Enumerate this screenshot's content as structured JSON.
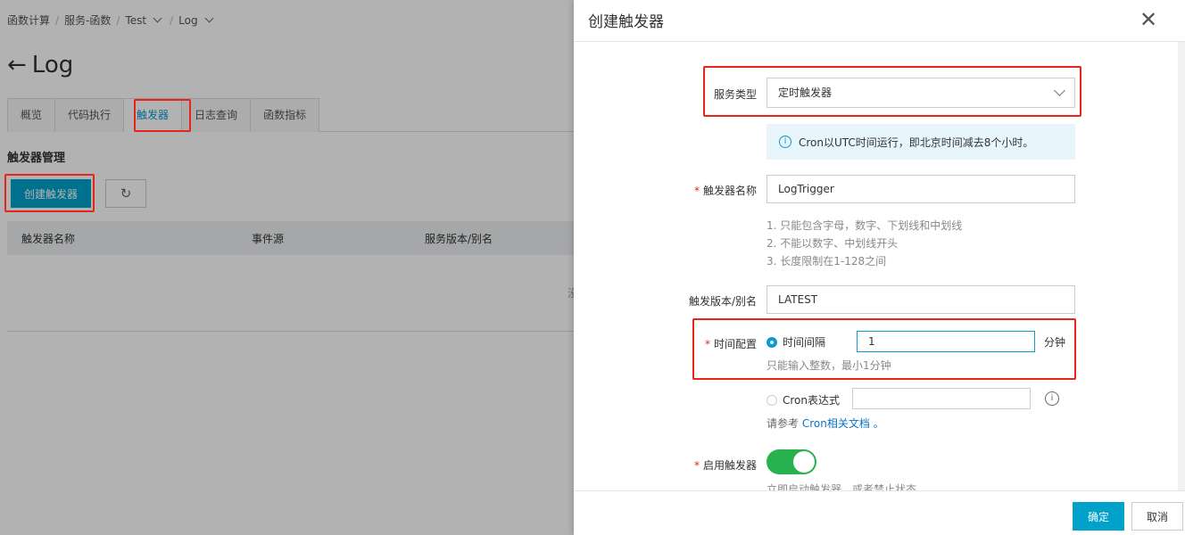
{
  "breadcrumb": {
    "items": [
      "函数计算",
      "服务-函数",
      "Test",
      "Log"
    ]
  },
  "page_title": "Log",
  "tabs": [
    "概览",
    "代码执行",
    "触发器",
    "日志查询",
    "函数指标"
  ],
  "section_title": "触发器管理",
  "create_trigger_button": "创建触发器",
  "table": {
    "headers": [
      "触发器名称",
      "事件源",
      "服务版本/别名"
    ],
    "partial_text": "没"
  },
  "panel": {
    "title": "创建触发器",
    "service_type_label": "服务类型",
    "service_type_value": "定时触发器",
    "info_text": "Cron以UTC时间运行，即北京时间减去8个小时。",
    "trigger_name_label": "触发器名称",
    "trigger_name_value": "LogTrigger",
    "name_rules": [
      "1. 只能包含字母，数字、下划线和中划线",
      "2. 不能以数字、中划线开头",
      "3. 长度限制在1-128之间"
    ],
    "version_label": "触发版本/别名",
    "version_value": "LATEST",
    "time_config_label": "时间配置",
    "interval_option": "时间间隔",
    "interval_value": "1",
    "interval_unit": "分钟",
    "interval_hint": "只能输入整数，最小1分钟",
    "cron_option": "Cron表达式",
    "cron_value": "",
    "cron_ref_prefix": "请参考",
    "cron_ref_link": "Cron相关文档",
    "cron_ref_suffix": "。",
    "enable_label": "启用触发器",
    "enable_hint": "立即启动触发器，或者禁止状态",
    "enabled": true,
    "ok_button": "确定",
    "cancel_button": "取消"
  },
  "colors": {
    "accent": "#00a2ca",
    "highlight_box": "#e5241a",
    "toggle_on": "#27b14f"
  }
}
